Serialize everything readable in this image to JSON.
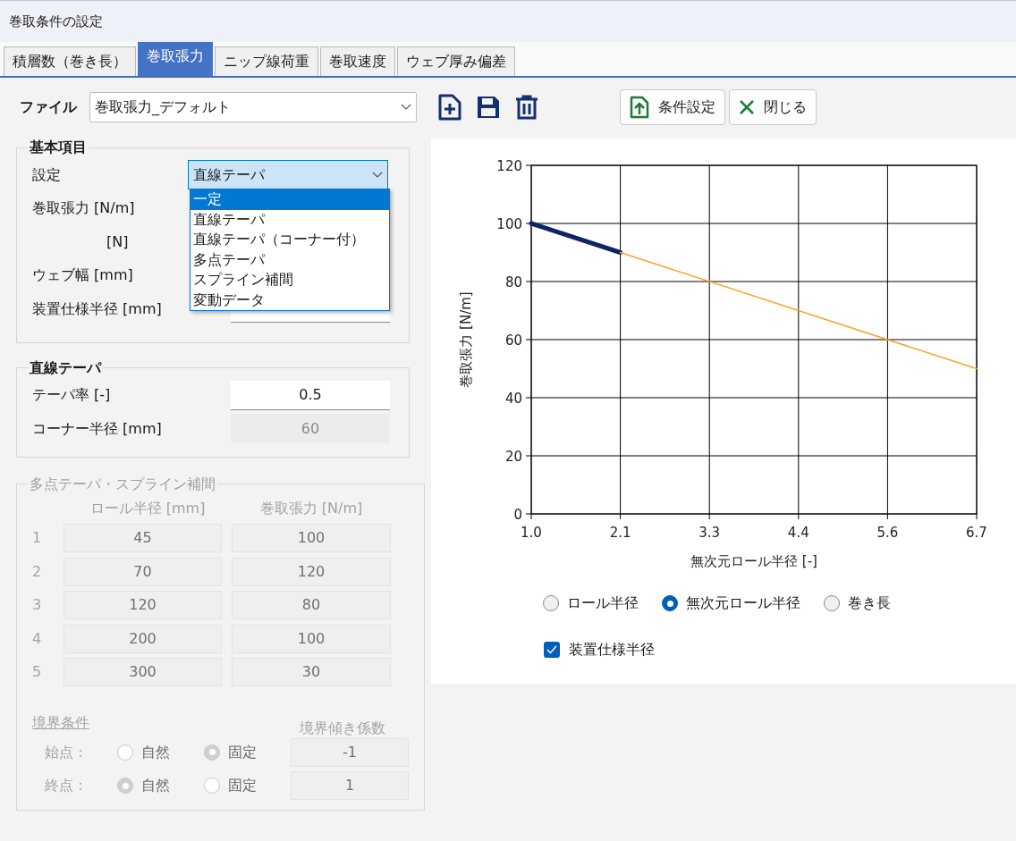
{
  "window": {
    "title": "巻取条件の設定"
  },
  "tabs": [
    {
      "label": "積層数（巻き長）",
      "selected": false
    },
    {
      "label": "巻取張力",
      "selected": true
    },
    {
      "label": "ニップ線荷重",
      "selected": false
    },
    {
      "label": "巻取速度",
      "selected": false
    },
    {
      "label": "ウェブ厚み偏差",
      "selected": false
    }
  ],
  "file": {
    "label": "ファイル",
    "value": "巻取張力_デフォルト"
  },
  "buttons": [
    {
      "label": "条件設定",
      "kind": "apply"
    },
    {
      "label": "閉じる",
      "kind": "close"
    }
  ],
  "basic": {
    "title": "基本項目",
    "rows": [
      {
        "label": "設定"
      },
      {
        "label": "巻取張力 [N/m]"
      },
      {
        "label": "[N]"
      },
      {
        "label": "ウェブ幅 [mm]"
      },
      {
        "label": "装置仕様半径 [mm]"
      }
    ],
    "setting_value": "直線テーパ",
    "dropdown_options": [
      {
        "label": "一定",
        "selected": true
      },
      {
        "label": "直線テーパ",
        "selected": false
      },
      {
        "label": "直線テーパ（コーナー付）",
        "selected": false
      },
      {
        "label": "多点テーパ",
        "selected": false
      },
      {
        "label": "スプライン補間",
        "selected": false
      },
      {
        "label": "変動データ",
        "selected": false
      }
    ]
  },
  "taper": {
    "title": "直線テーパ",
    "rows": [
      {
        "label": "テーパ率 [-]",
        "value": "0.5",
        "disabled": false
      },
      {
        "label": "コーナー半径 [mm]",
        "value": "60",
        "disabled": true
      }
    ]
  },
  "multipoint": {
    "title": "多点テーパ・スプライン補間",
    "disabled": true,
    "columns": [
      "ロール半径 [mm]",
      "巻取張力 [N/m]"
    ],
    "rows": [
      {
        "index": "1",
        "radius": "45",
        "tension": "100"
      },
      {
        "index": "2",
        "radius": "70",
        "tension": "120"
      },
      {
        "index": "3",
        "radius": "120",
        "tension": "80"
      },
      {
        "index": "4",
        "radius": "200",
        "tension": "100"
      },
      {
        "index": "5",
        "radius": "300",
        "tension": "30"
      }
    ],
    "boundary": {
      "title": "境界条件",
      "coef_header": "境界傾き係数",
      "rows": [
        {
          "label": "始点：",
          "options": [
            {
              "label": "自然",
              "selected": false
            },
            {
              "label": "固定",
              "selected": true
            }
          ],
          "value": "-1"
        },
        {
          "label": "終点：",
          "options": [
            {
              "label": "自然",
              "selected": true
            },
            {
              "label": "固定",
              "selected": false
            }
          ],
          "value": "1"
        }
      ]
    }
  },
  "chart": {
    "chart_data": {
      "type": "line",
      "xlabel": "無次元ロール半径 [-]",
      "ylabel": "巻取張力 [N/m]",
      "x": [
        1.0,
        2.14,
        6.7
      ],
      "series": [
        {
          "color": "#0f2466",
          "values": [
            100,
            90,
            null
          ]
        },
        {
          "color": "#f5a623",
          "values": [
            null,
            90,
            50
          ]
        }
      ],
      "grid": true,
      "xlim": [
        1.0,
        6.7
      ],
      "ylim": [
        0,
        120
      ],
      "xticks": [
        {
          "value": 1.0,
          "label": "1.0"
        },
        {
          "value": 2.14,
          "label": "2.1"
        },
        {
          "value": 3.28,
          "label": "3.3"
        },
        {
          "value": 4.42,
          "label": "4.4"
        },
        {
          "value": 5.56,
          "label": "5.6"
        },
        {
          "value": 6.7,
          "label": "6.7"
        }
      ],
      "yticks": [
        0,
        20,
        40,
        60,
        80,
        100,
        120
      ]
    },
    "axis_options": [
      {
        "label": "ロール半径",
        "selected": false
      },
      {
        "label": "無次元ロール半径",
        "selected": true
      },
      {
        "label": "巻き長",
        "selected": false
      }
    ],
    "show_radius": {
      "label": "装置仕様半径",
      "checked": true
    }
  }
}
